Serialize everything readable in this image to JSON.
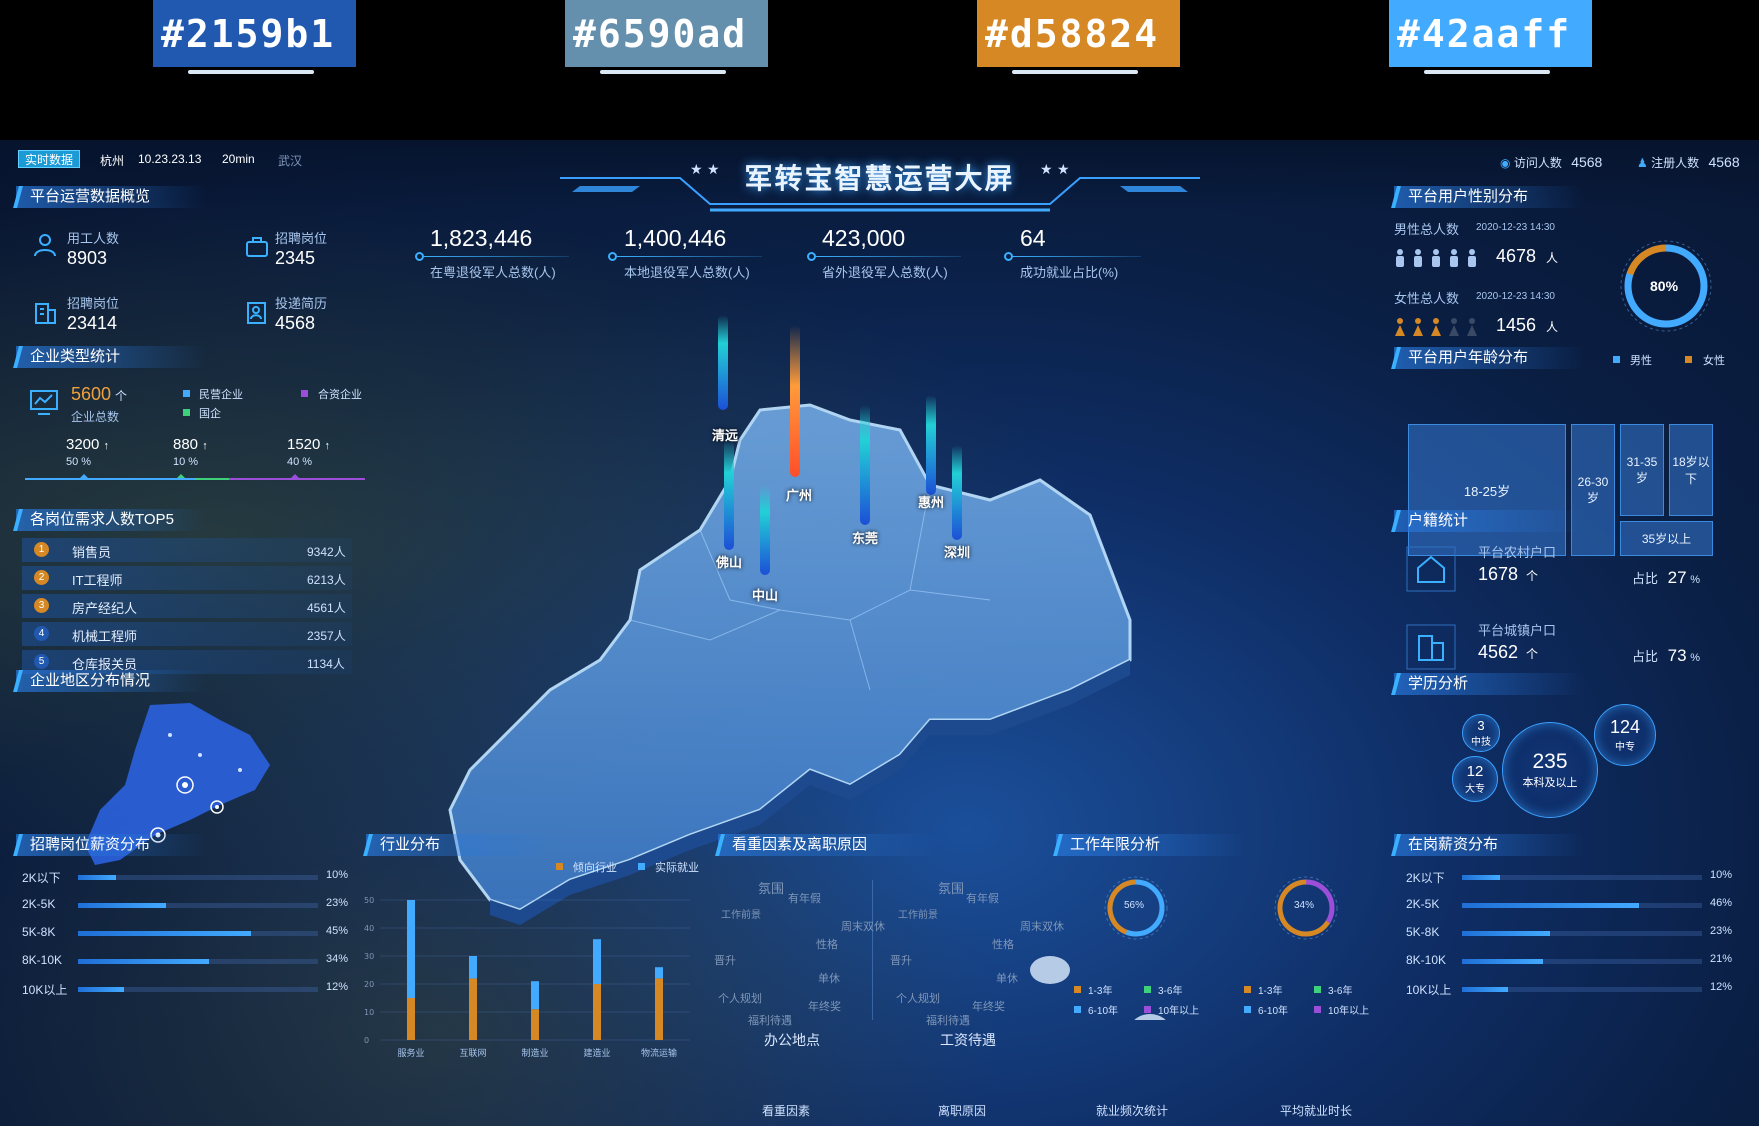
{
  "palette": [
    "#2159b1",
    "#6590ad",
    "#d58824",
    "#42aaff"
  ],
  "header": {
    "live_tag": "实时数据",
    "city": "杭州",
    "time": "10.23.23.13",
    "interval": "20min",
    "city2": "武汉",
    "title": "军转宝智慧运营大屏",
    "visitors_label": "访问人数",
    "visitors_value": "4568",
    "registered_label": "注册人数",
    "registered_value": "4568"
  },
  "overview": {
    "title": "平台运营数据概览",
    "items": [
      {
        "label": "用工人数",
        "value": "8903"
      },
      {
        "label": "招聘岗位",
        "value": "2345"
      },
      {
        "label": "招聘岗位",
        "value": "23414"
      },
      {
        "label": "投递简历",
        "value": "4568"
      }
    ]
  },
  "kpis": [
    {
      "value": "1,823,446",
      "label": "在粤退役军人总数(人)"
    },
    {
      "value": "1,400,446",
      "label": "本地退役军人总数(人)"
    },
    {
      "value": "423,000",
      "label": "省外退役军人总数(人)"
    },
    {
      "value": "64",
      "label": "成功就业占比(%)"
    }
  ],
  "enterprise": {
    "title": "企业类型统计",
    "total": "5600",
    "total_unit": "个",
    "total_label": "企业总数",
    "legend": [
      "民营企业",
      "合资企业",
      "国企"
    ],
    "breakdown": [
      {
        "value": "3200",
        "pct": "50"
      },
      {
        "value": "880",
        "pct": "10"
      },
      {
        "value": "1520",
        "pct": "40"
      }
    ],
    "colors": [
      "#42aaff",
      "#3ed07a",
      "#9b4fd8"
    ]
  },
  "top5": {
    "title": "各岗位需求人数TOP5",
    "rows": [
      {
        "rank": "1",
        "name": "销售员",
        "value": "9342人"
      },
      {
        "rank": "2",
        "name": "IT工程师",
        "value": "6213人"
      },
      {
        "rank": "3",
        "name": "房产经纪人",
        "value": "4561人"
      },
      {
        "rank": "4",
        "name": "机械工程师",
        "value": "2357人"
      },
      {
        "rank": "5",
        "name": "仓库报关员",
        "value": "1134人"
      }
    ]
  },
  "region": {
    "title": "企业地区分布情况"
  },
  "map": {
    "cities": [
      "清远",
      "广州",
      "惠州",
      "佛山",
      "东莞",
      "深圳",
      "中山"
    ]
  },
  "gender": {
    "title": "平台用户性别分布",
    "male_label": "男性总人数",
    "male_date": "2020-12-23 14:30",
    "male_value": "4678",
    "female_label": "女性总人数",
    "female_date": "2020-12-23 14:30",
    "female_value": "1456",
    "unit": "人",
    "ring_pct": "80%",
    "ring_fraction": 0.8,
    "legend_male": "男性",
    "legend_female": "女性"
  },
  "age": {
    "title": "平台用户年龄分布",
    "labels": [
      "18-25岁",
      "26-30岁",
      "31-35岁",
      "18岁以下",
      "35岁以上"
    ]
  },
  "household": {
    "title": "户籍统计",
    "rural_label": "平台农村户口",
    "rural_value": "1678",
    "rural_unit": "个",
    "rural_pct_label": "占比",
    "rural_pct": "27",
    "urban_label": "平台城镇户口",
    "urban_value": "4562",
    "urban_unit": "个",
    "urban_pct_label": "占比",
    "urban_pct": "73",
    "pct_unit": "%"
  },
  "education": {
    "title": "学历分析",
    "bubbles": [
      {
        "value": "3",
        "label": "中技"
      },
      {
        "value": "235",
        "label": "本科及以上"
      },
      {
        "value": "124",
        "label": "中专"
      },
      {
        "value": "12",
        "label": "大专"
      }
    ]
  },
  "salary_recruit": {
    "title": "招聘岗位薪资分布",
    "rows": [
      {
        "label": "2K以下",
        "pct": "10%",
        "fraction": 0.1
      },
      {
        "label": "2K-5K",
        "pct": "23%",
        "fraction": 0.23
      },
      {
        "label": "5K-8K",
        "pct": "45%",
        "fraction": 0.45
      },
      {
        "label": "8K-10K",
        "pct": "34%",
        "fraction": 0.34
      },
      {
        "label": "10K以上",
        "pct": "12%",
        "fraction": 0.12
      }
    ]
  },
  "industry": {
    "title": "行业分布",
    "chart_data": {
      "type": "bar",
      "categories": [
        "服务业",
        "互联网",
        "制造业",
        "建造业",
        "物流运输"
      ],
      "series": [
        {
          "name": "倾向行业",
          "values": [
            15,
            22,
            11,
            20,
            22
          ],
          "color": "#d58824"
        },
        {
          "name": "实际就业",
          "values": [
            35,
            8,
            10,
            16,
            4
          ],
          "color": "#42aaff"
        }
      ],
      "yticks": [
        "50",
        "40",
        "30",
        "20",
        "10",
        "0"
      ],
      "ylim": [
        0,
        50
      ]
    }
  },
  "factors": {
    "title": "看重因素及离职原因",
    "left_caption": "看重因素",
    "right_caption": "离职原因",
    "left_center": "办公地点",
    "right_center": "工资待遇",
    "words": [
      "氛围",
      "有年假",
      "工作前景",
      "周末双休",
      "性格",
      "晋升",
      "单休",
      "个人规划",
      "年终奖",
      "福利待遇"
    ]
  },
  "work_years": {
    "title": "工作年限分析",
    "ring1_pct": "56%",
    "ring1_fraction": 0.56,
    "ring1_caption": "就业频次统计",
    "ring2_pct": "34%",
    "ring2_fraction": 0.34,
    "ring2_caption": "平均就业时长",
    "legend": [
      "1-3年",
      "3-6年",
      "6-10年",
      "10年以上"
    ],
    "legend_colors": [
      "#d58824",
      "#3ed07a",
      "#42aaff",
      "#9b4fd8"
    ]
  },
  "salary_onjob": {
    "title": "在岗薪资分布",
    "rows": [
      {
        "label": "2K以下",
        "pct": "10%",
        "fraction": 0.1
      },
      {
        "label": "2K-5K",
        "pct": "46%",
        "fraction": 0.46
      },
      {
        "label": "5K-8K",
        "pct": "23%",
        "fraction": 0.23
      },
      {
        "label": "8K-10K",
        "pct": "21%",
        "fraction": 0.21
      },
      {
        "label": "10K以上",
        "pct": "12%",
        "fraction": 0.12
      }
    ]
  }
}
